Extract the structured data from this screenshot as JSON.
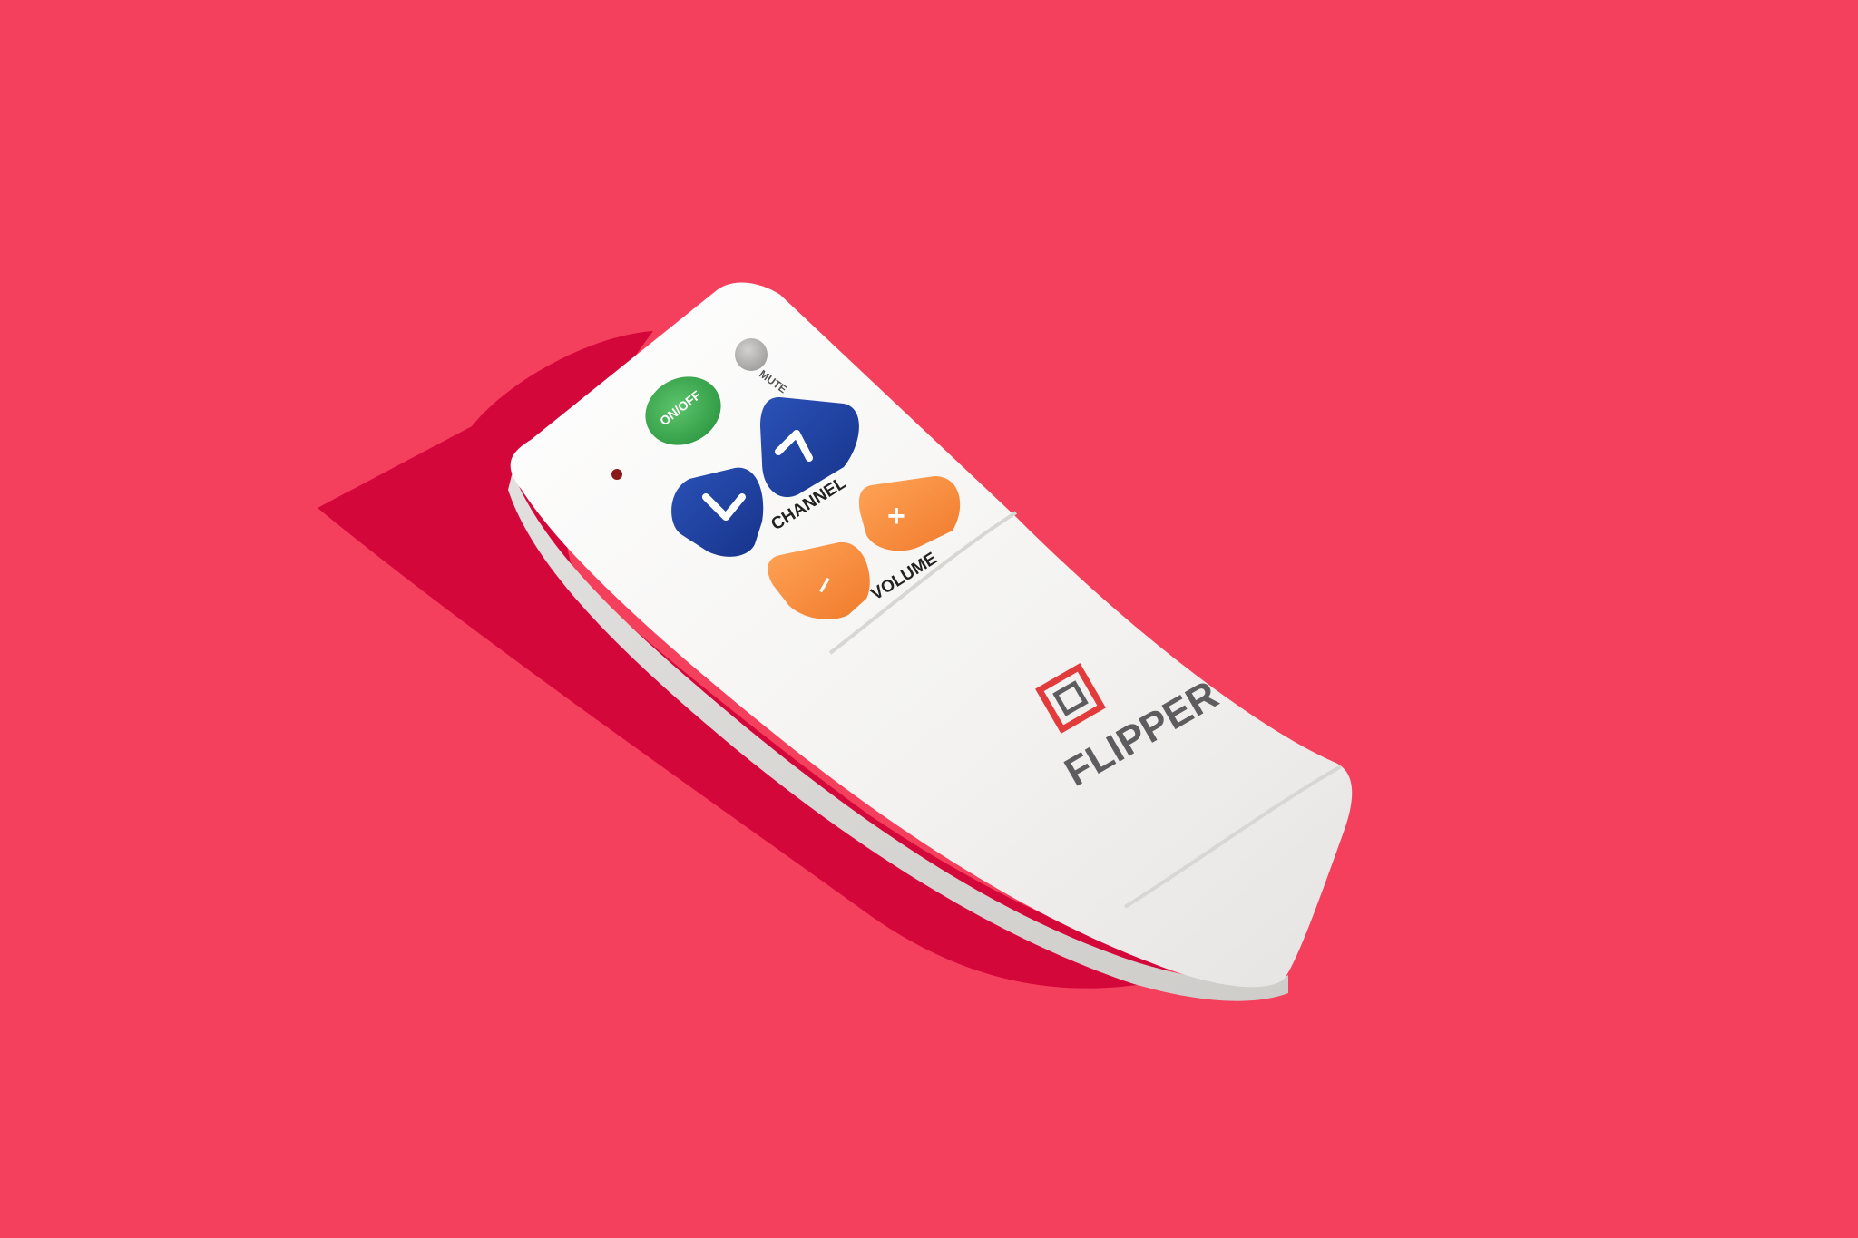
{
  "photo": {
    "background_color": "#f4405c",
    "shadow_color": "#d4073a",
    "remote_color": "#f4f3f1"
  },
  "remote": {
    "buttons": {
      "mute": {
        "label": "MUTE",
        "color": "#b7b6b4"
      },
      "power": {
        "label": "ON/OFF",
        "color": "#35a84c"
      },
      "channel_up": {
        "icon": "chevron-up-icon",
        "color": "#1d3f9e"
      },
      "channel_down": {
        "icon": "chevron-down-icon",
        "color": "#1d3f9e"
      },
      "volume_up": {
        "label": "+",
        "color": "#f78d3f"
      },
      "volume_down": {
        "label": "–",
        "color": "#f78d3f"
      }
    },
    "labels": {
      "channel": "CHANNEL",
      "volume": "VOLUME"
    },
    "brand": {
      "name": "FLIPPER",
      "logo_color": "#e23b3b",
      "text_color": "#5d5d5f"
    }
  }
}
